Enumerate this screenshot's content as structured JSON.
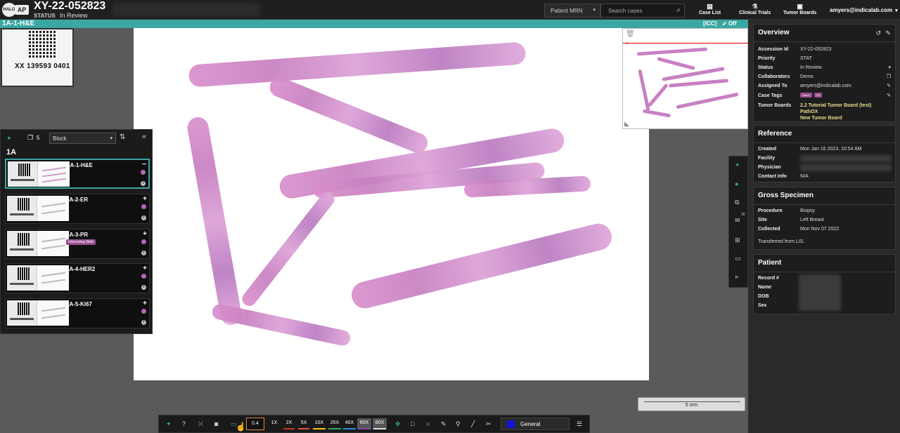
{
  "header": {
    "logo_text": "HALO",
    "logo_ap": "AP",
    "case_id": "XY-22-052823",
    "status_label": "STATUS",
    "status_value": "In Review",
    "mrn_select": "Patient MRN",
    "search_placeholder": "Search cases",
    "nav": [
      {
        "label": "Case List",
        "icon": "list-icon"
      },
      {
        "label": "Clinical Trials",
        "icon": "flask-icon"
      },
      {
        "label": "Tumor Boards",
        "icon": "board-icon"
      }
    ],
    "user": "amyers@indicalab.com"
  },
  "slide_bar": {
    "title": "1A-1-H&E",
    "icc": "[ICC]",
    "off": "Off"
  },
  "label": {
    "text": "XX 139593 0401"
  },
  "slide_panel": {
    "count": "5",
    "group_select": "Block",
    "block_title": "1A",
    "slides": [
      {
        "name": "1A-1-H&E",
        "tag": "",
        "action": "−",
        "active": true
      },
      {
        "name": "1A-2-ER",
        "tag": "",
        "action": "+",
        "active": false
      },
      {
        "name": "1A-3-PR",
        "tag": "Interesting Slide",
        "action": "+",
        "active": false
      },
      {
        "name": "1A-4-HER2",
        "tag": "",
        "action": "+",
        "active": false
      },
      {
        "name": "1A-5-Ki67",
        "tag": "",
        "action": "+",
        "active": false
      }
    ]
  },
  "overview": {
    "title": "Overview",
    "rows": [
      {
        "key": "Accession Id",
        "value": "XY-22-052823"
      },
      {
        "key": "Priority",
        "value": "STAT"
      },
      {
        "key": "Status",
        "value": "In Review"
      },
      {
        "key": "Collaborators",
        "value": "Demo"
      },
      {
        "key": "Assigned To",
        "value": "amyers@indicalab.com"
      },
      {
        "key": "Case Tags",
        "value": ""
      },
      {
        "key": "Tumor Boards",
        "value": ""
      }
    ],
    "case_tags": [
      "Demo",
      "G3"
    ],
    "tumor_boards": [
      "2.2 Tutorial Tumor Board (test)",
      "PathOX",
      "New Tumor Board"
    ]
  },
  "reference": {
    "title": "Reference",
    "created_key": "Created",
    "created_val": "Mon Jan 16 2023, 10:54 AM",
    "facility_key": "Facility",
    "physician_key": "Physician",
    "contact_key": "Contact Info",
    "contact_val": "N/A"
  },
  "gross": {
    "title": "Gross Specimen",
    "procedure_key": "Procedure",
    "procedure_val": "Biopsy",
    "site_key": "Site",
    "site_val": "Left Breast",
    "collected_key": "Collected",
    "collected_val": "Mon Nov 07 2022",
    "note": "Transferred from LIS."
  },
  "patient": {
    "title": "Patient",
    "keys": [
      "Record #",
      "Name",
      "DOB",
      "Sex"
    ]
  },
  "tool_strip": {
    "badge": "35"
  },
  "scale": {
    "label": "5 mm"
  },
  "toolbar": {
    "zoom_value": "0.4",
    "zoom_levels": [
      {
        "label": "1X",
        "color": ""
      },
      {
        "label": "2X",
        "color": "#c0392b"
      },
      {
        "label": "5X",
        "color": "#e74c3c"
      },
      {
        "label": "10X",
        "color": "#f1c40f"
      },
      {
        "label": "20X",
        "color": "#27ae60"
      },
      {
        "label": "40X",
        "color": "#2e86de"
      },
      {
        "label": "60X",
        "color": "#8e44ad"
      },
      {
        "label": "80X",
        "color": "#dddddd"
      }
    ],
    "layer_name": "General",
    "layer_color": "#1414d6"
  }
}
